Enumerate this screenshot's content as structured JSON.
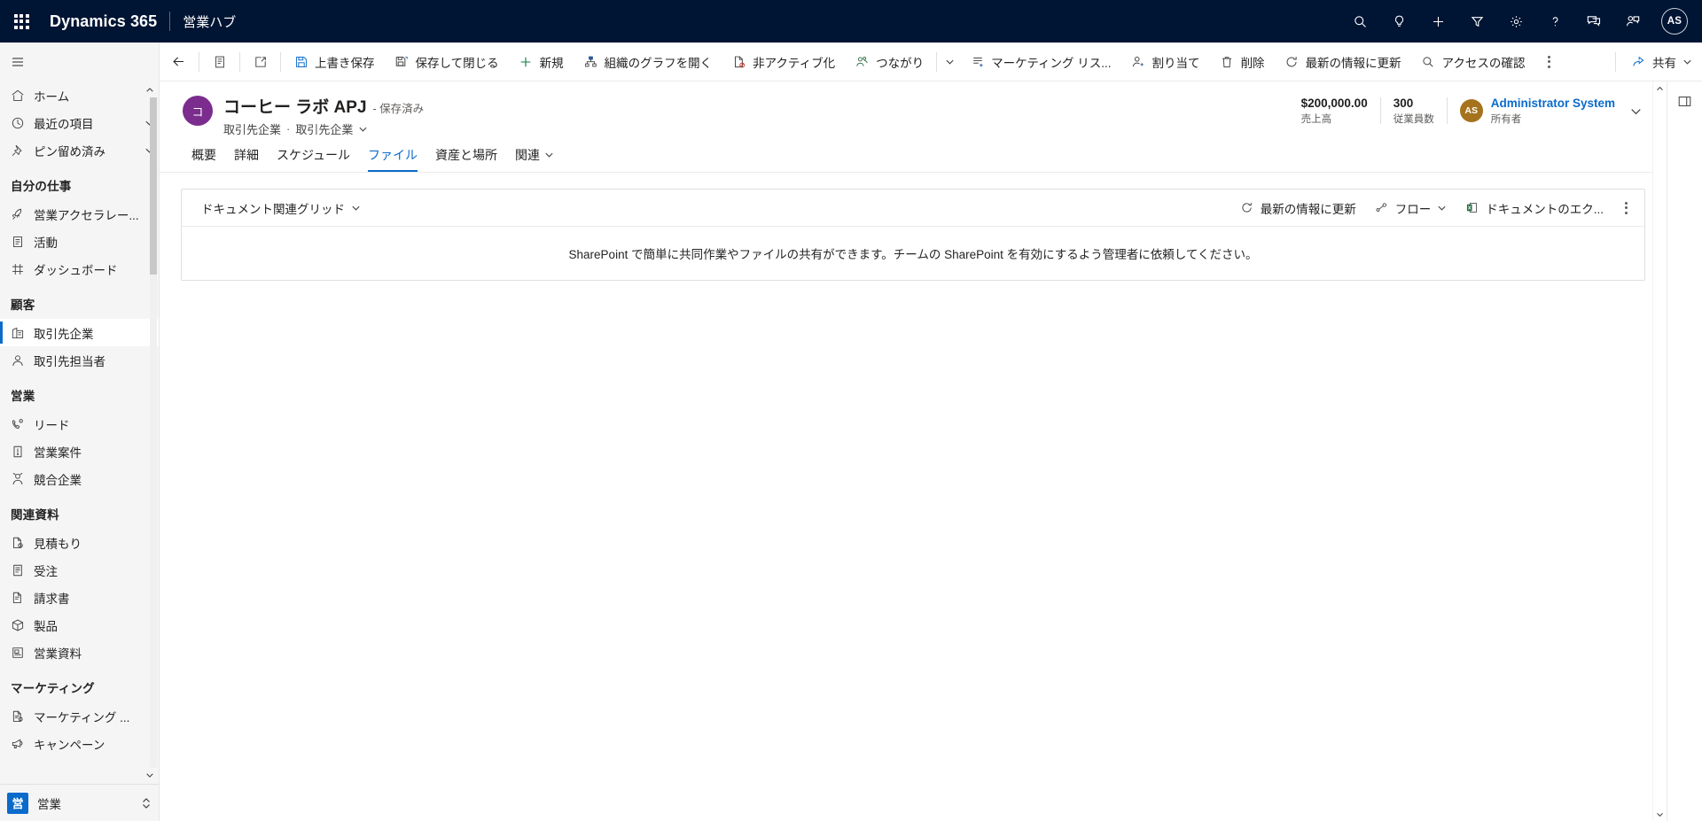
{
  "topbar": {
    "waffle_label": "app-launcher",
    "brand": "Dynamics 365",
    "app_name": "営業ハブ",
    "actions": [
      {
        "name": "search-icon",
        "label": "検索"
      },
      {
        "name": "insights-icon",
        "label": "インサイト"
      },
      {
        "name": "quick-create-icon",
        "label": "新規作成"
      },
      {
        "name": "filter-icon",
        "label": "フィルター"
      },
      {
        "name": "settings-gear-icon",
        "label": "設定"
      },
      {
        "name": "help-icon",
        "label": "ヘルプ"
      },
      {
        "name": "feedback-chat-icon",
        "label": "フィードバック"
      },
      {
        "name": "assistant-icon",
        "label": "アシスタント"
      }
    ],
    "avatar_initials": "AS"
  },
  "sidebar": {
    "hamburger_label": "サイト マップ",
    "items": [
      {
        "label": "ホーム",
        "icon": "home-icon",
        "type": "item",
        "chevron": false,
        "selected": false
      },
      {
        "label": "最近の項目",
        "icon": "clock-icon",
        "type": "item",
        "chevron": true,
        "selected": false
      },
      {
        "label": "ピン留め済み",
        "icon": "pin-icon",
        "type": "item",
        "chevron": true,
        "selected": false
      },
      {
        "label": "自分の仕事",
        "type": "group"
      },
      {
        "label": "営業アクセラレー...",
        "icon": "rocket-icon",
        "type": "item",
        "chevron": false,
        "selected": false
      },
      {
        "label": "活動",
        "icon": "activity-icon",
        "type": "item",
        "chevron": false,
        "selected": false
      },
      {
        "label": "ダッシュボード",
        "icon": "dashboard-icon",
        "type": "item",
        "chevron": false,
        "selected": false
      },
      {
        "label": "顧客",
        "type": "group"
      },
      {
        "label": "取引先企業",
        "icon": "account-icon",
        "type": "item",
        "chevron": false,
        "selected": true
      },
      {
        "label": "取引先担当者",
        "icon": "contact-icon",
        "type": "item",
        "chevron": false,
        "selected": false
      },
      {
        "label": "営業",
        "type": "group"
      },
      {
        "label": "リード",
        "icon": "lead-icon",
        "type": "item",
        "chevron": false,
        "selected": false
      },
      {
        "label": "営業案件",
        "icon": "opportunity-icon",
        "type": "item",
        "chevron": false,
        "selected": false
      },
      {
        "label": "競合企業",
        "icon": "competitor-icon",
        "type": "item",
        "chevron": false,
        "selected": false
      },
      {
        "label": "関連資料",
        "type": "group"
      },
      {
        "label": "見積もり",
        "icon": "quote-icon",
        "type": "item",
        "chevron": false,
        "selected": false
      },
      {
        "label": "受注",
        "icon": "order-icon",
        "type": "item",
        "chevron": false,
        "selected": false
      },
      {
        "label": "請求書",
        "icon": "invoice-icon",
        "type": "item",
        "chevron": false,
        "selected": false
      },
      {
        "label": "製品",
        "icon": "product-box-icon",
        "type": "item",
        "chevron": false,
        "selected": false
      },
      {
        "label": "営業資料",
        "icon": "sales-literature-icon",
        "type": "item",
        "chevron": false,
        "selected": false
      },
      {
        "label": "マーケティング",
        "type": "group"
      },
      {
        "label": "マーケティング ...",
        "icon": "marketing-list-icon",
        "type": "item",
        "chevron": false,
        "selected": false
      },
      {
        "label": "キャンペーン",
        "icon": "campaign-icon",
        "type": "item",
        "chevron": false,
        "selected": false
      }
    ],
    "app_switcher": {
      "tile_text": "営",
      "label": "営業"
    }
  },
  "commandbar": {
    "back_label": "戻る",
    "form_icon_label": "フォーム",
    "popout_label": "新しいウィンドウで開く",
    "buttons": [
      {
        "label": "上書き保存",
        "icon": "save-icon"
      },
      {
        "label": "保存して閉じる",
        "icon": "save-close-icon"
      },
      {
        "label": "新規",
        "icon": "plus-icon"
      },
      {
        "label": "組織のグラフを開く",
        "icon": "org-chart-icon"
      },
      {
        "label": "非アクティブ化",
        "icon": "deactivate-icon"
      },
      {
        "label": "つながり",
        "icon": "connections-icon"
      }
    ],
    "buttons_after": [
      {
        "label": "マーケティング リス...",
        "icon": "add-to-list-icon"
      },
      {
        "label": "割り当て",
        "icon": "assign-user-icon"
      },
      {
        "label": "削除",
        "icon": "trash-icon"
      },
      {
        "label": "最新の情報に更新",
        "icon": "refresh-icon"
      },
      {
        "label": "アクセスの確認",
        "icon": "check-access-icon"
      }
    ],
    "overflow_label": "その他のコマンド",
    "share_label": "共有",
    "panel_label": "サイド パネル"
  },
  "record": {
    "avatar_text": "コ",
    "title": "コーヒー ラボ APJ",
    "saved_status": "- 保存済み",
    "entity": "取引先企業",
    "form_name": "取引先企業",
    "stats": [
      {
        "value": "$200,000.00",
        "label": "売上高"
      },
      {
        "value": "300",
        "label": "従業員数"
      }
    ],
    "owner": {
      "initials": "AS",
      "name": "Administrator System",
      "label": "所有者"
    }
  },
  "tabs": [
    {
      "label": "概要",
      "active": false,
      "chevron": false
    },
    {
      "label": "詳細",
      "active": false,
      "chevron": false
    },
    {
      "label": "スケジュール",
      "active": false,
      "chevron": false
    },
    {
      "label": "ファイル",
      "active": true,
      "chevron": false
    },
    {
      "label": "資産と場所",
      "active": false,
      "chevron": false
    },
    {
      "label": "関連",
      "active": false,
      "chevron": true
    }
  ],
  "grid": {
    "view_name": "ドキュメント関連グリッド",
    "toolbar": [
      {
        "label": "最新の情報に更新",
        "icon": "refresh-icon",
        "chevron": false
      },
      {
        "label": "フロー",
        "icon": "flow-icon",
        "chevron": true
      },
      {
        "label": "ドキュメントのエク...",
        "icon": "excel-icon",
        "chevron": false
      }
    ],
    "more_label": "その他のコマンド",
    "message": "SharePoint で簡単に共同作業やファイルの共有ができます。チームの SharePoint を有効にするよう管理者に依頼してください。"
  },
  "colors": {
    "header_bg": "#001433",
    "accent": "#0b6bcb",
    "record_avatar": "#7b2d8e",
    "owner_avatar": "#a5731d",
    "app_tile": "#0b6bcb"
  }
}
